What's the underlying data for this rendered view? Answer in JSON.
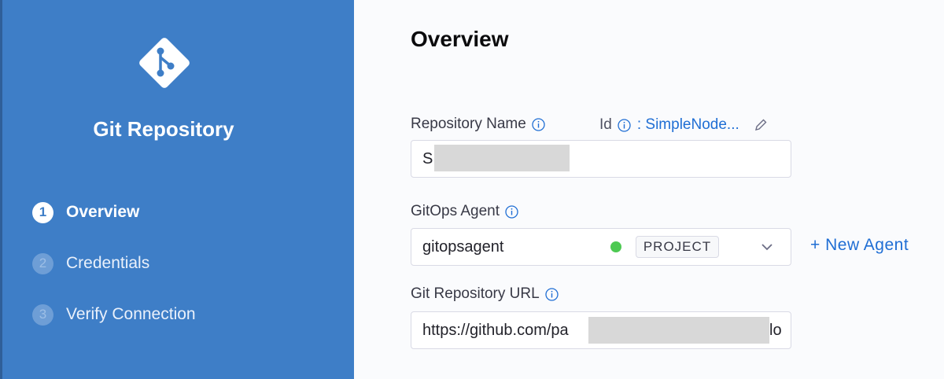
{
  "sidebar": {
    "title": "Git Repository",
    "steps": [
      {
        "num": "1",
        "label": "Overview"
      },
      {
        "num": "2",
        "label": "Credentials"
      },
      {
        "num": "3",
        "label": "Verify Connection"
      }
    ]
  },
  "main": {
    "title": "Overview",
    "repo_name": {
      "label": "Repository Name",
      "value": "S",
      "id_label": "Id",
      "id_value": ": SimpleNode..."
    },
    "gitops_agent": {
      "label": "GitOps Agent",
      "value": "gitopsagent",
      "badge": "PROJECT",
      "status_color": "#4dc952",
      "new_agent": "+ New Agent"
    },
    "git_url": {
      "label": "Git Repository URL",
      "value_prefix": "https://github.com/pa",
      "value_suffix": "lo"
    }
  },
  "colors": {
    "sidebar": "#3e7ec7",
    "accent": "#1f6ed4"
  }
}
